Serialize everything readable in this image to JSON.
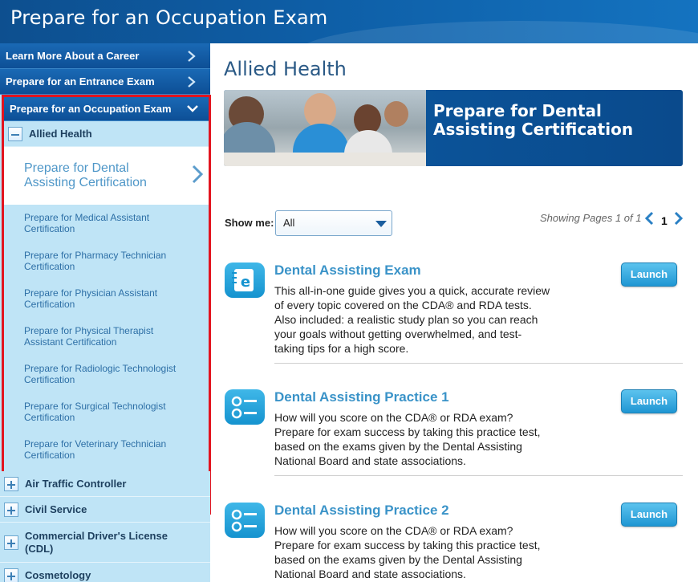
{
  "header": {
    "title": "Prepare for an Occupation Exam"
  },
  "sidebar": {
    "top_links": [
      {
        "label": "Learn More About a Career"
      },
      {
        "label": "Prepare for an Entrance Exam"
      },
      {
        "label": "Prepare for an Occupation Exam"
      }
    ],
    "expanded_group": {
      "label": "Allied Health",
      "selected": "Prepare for Dental Assisting Certification",
      "items": [
        "Prepare for Medical Assistant Certification",
        "Prepare for Pharmacy Technician Certification",
        "Prepare for Physician Assistant Certification",
        "Prepare for Physical Therapist Assistant Certification",
        "Prepare for Radiologic Technologist Certification",
        "Prepare for Surgical Technologist Certification",
        "Prepare for Veterinary Technician Certification"
      ]
    },
    "other_groups": [
      "Air Traffic Controller",
      "Civil Service",
      "Commercial Driver's License (CDL)",
      "Cosmetology"
    ]
  },
  "main": {
    "title": "Allied Health",
    "banner_text": "Prepare for Dental Assisting Certification",
    "filter": {
      "label": "Show me:",
      "value": "All"
    },
    "paging": {
      "text": "Showing Pages 1 of 1",
      "current": "1"
    },
    "items": [
      {
        "title": "Dental Assisting Exam",
        "icon": "ebook-icon",
        "description": "This all-in-one guide gives you a quick, accurate review of every topic covered on the CDA® and RDA tests. Also included: a realistic study plan so you can reach your goals without getting overwhelmed, and test-taking tips for a high score.",
        "button": "Launch"
      },
      {
        "title": "Dental Assisting Practice 1",
        "icon": "practice-test-icon",
        "description": "How will you score on the CDA® or RDA exam? Prepare for exam success by taking this practice test, based on the exams given by the Dental Assisting National Board and state associations.",
        "button": "Launch"
      },
      {
        "title": "Dental Assisting Practice 2",
        "icon": "practice-test-icon",
        "description": "How will you score on the CDA® or RDA exam? Prepare for exam success by taking this practice test, based on the exams given by the Dental Assisting National Board and state associations.",
        "button": "Launch"
      }
    ]
  },
  "colors": {
    "header": "#0e5ea6",
    "sidebar": "#bfe4f6",
    "highlight_border": "#e2141f",
    "accent": "#3a93c8"
  }
}
